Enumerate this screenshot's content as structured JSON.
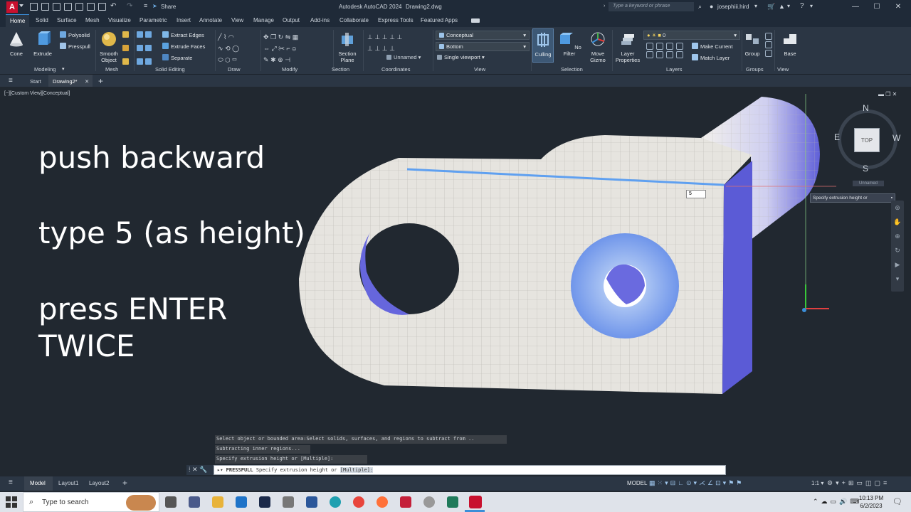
{
  "app": {
    "title": "Autodesk AutoCAD 2024",
    "document": "Drawing2.dwg",
    "share_label": "Share",
    "search_placeholder": "Type a keyword or phrase",
    "user": "josephiii.hird"
  },
  "ribbon": {
    "tabs": [
      "Home",
      "Solid",
      "Surface",
      "Mesh",
      "Visualize",
      "Parametric",
      "Insert",
      "Annotate",
      "View",
      "Manage",
      "Output",
      "Add-ins",
      "Collaborate",
      "Express Tools",
      "Featured Apps"
    ],
    "active_tab": "Home",
    "modeling": {
      "box": "Cone",
      "extrude": "Extrude",
      "polysolid": "Polysolid",
      "presspull": "Presspull",
      "panel": "Modeling"
    },
    "mesh": {
      "smooth": "Smooth Object",
      "panel": "Mesh"
    },
    "solid_editing": {
      "extract_edges": "Extract Edges",
      "extrude_faces": "Extrude Faces",
      "separate": "Separate",
      "panel": "Solid Editing"
    },
    "draw": {
      "panel": "Draw"
    },
    "modify": {
      "panel": "Modify"
    },
    "section": {
      "plane": "Section Plane",
      "panel": "Section"
    },
    "coordinates": {
      "ucs": "Unnamed",
      "panel": "Coordinates"
    },
    "view": {
      "visual_style": "Conceptual",
      "view_dir": "Bottom",
      "viewport": "Single viewport",
      "panel": "View"
    },
    "selection": {
      "culling": "Culling",
      "no_filter": "No Filter",
      "move_gizmo": "Move Gizmo",
      "panel": "Selection"
    },
    "layers": {
      "properties": "Layer Properties",
      "layer_value": "0",
      "make_current": "Make Current",
      "match_layer": "Match Layer",
      "panel": "Layers"
    },
    "groups": {
      "group": "Group",
      "panel": "Groups"
    },
    "base": {
      "label": "Base",
      "panel": "View"
    }
  },
  "filetabs": {
    "start": "Start",
    "drawing": "Drawing2*"
  },
  "viewport": {
    "label": "[−][Custom View][Conceptual]",
    "instructions": {
      "line1": "push backward",
      "line2": "type 5 (as height)",
      "line3a": "press ENTER",
      "line3b": "TWICE"
    },
    "dyn_input_value": "5",
    "tooltip": "Specify extrusion height or",
    "viewcube": {
      "face": "TOP",
      "north": "N",
      "south": "S",
      "east": "E",
      "west": "W",
      "ucs_label": "Unnamed"
    }
  },
  "command": {
    "history": [
      "Select object or bounded area:Select solids, surfaces, and regions to subtract from ..",
      "Subtracting inner regions...",
      "Specify extrusion height or [Multiple]:"
    ],
    "prompt_cmd": "PRESSPULL",
    "prompt_text": "Specify extrusion height or",
    "prompt_option": "[Multiple]:"
  },
  "status": {
    "model_tab": "Model",
    "layouts": [
      "Layout1",
      "Layout2"
    ],
    "model_label": "MODEL",
    "scale": "1:1"
  },
  "taskbar": {
    "search_placeholder": "Type to search",
    "time": "10:13 PM",
    "date": "6/2/2023"
  },
  "colors": {
    "accent": "#3b8ed8",
    "face_light": "#e6e4df",
    "face_blue": "#5b5bd6",
    "brand_red": "#c8102e"
  }
}
